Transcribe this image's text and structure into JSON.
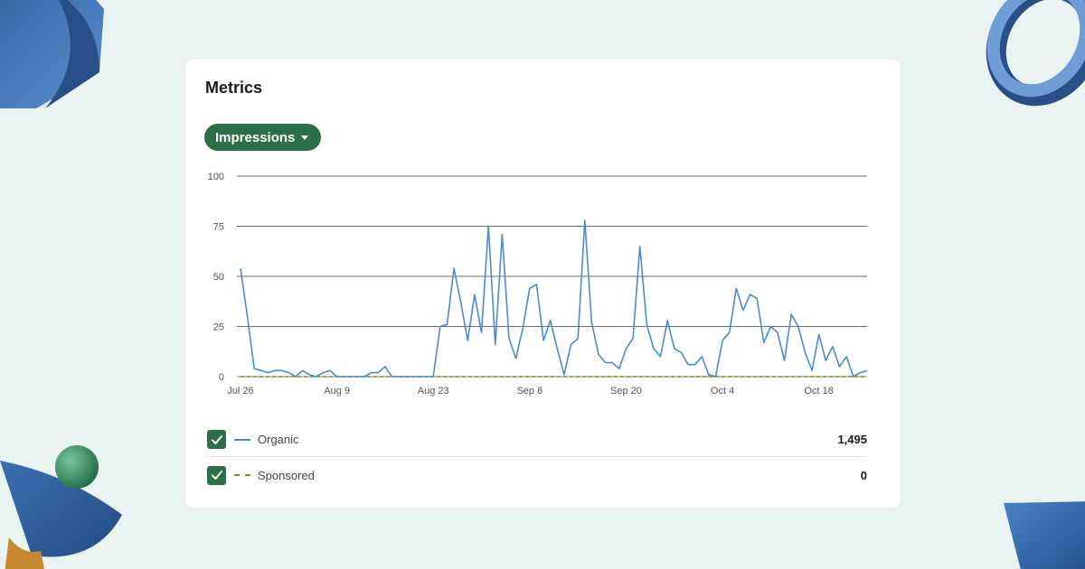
{
  "card": {
    "title": "Metrics",
    "metric_selector": {
      "selected": "Impressions"
    }
  },
  "colors": {
    "organic": "#4a8ad4",
    "sponsored": "#7b8f1a",
    "accent": "#2c6e47"
  },
  "legend": [
    {
      "name": "Organic",
      "total": "1,495",
      "checked": true,
      "style": "solid"
    },
    {
      "name": "Sponsored",
      "total": "0",
      "checked": true,
      "style": "dashed"
    }
  ],
  "chart_data": {
    "type": "line",
    "x_start": "2023-07-26",
    "x_end": "2023-10-25",
    "ylim": [
      0,
      100
    ],
    "yticks": [
      0,
      25,
      50,
      75,
      100
    ],
    "xticks": [
      {
        "label": "Jul 26",
        "day": 0
      },
      {
        "label": "Aug 9",
        "day": 14
      },
      {
        "label": "Aug 23",
        "day": 28
      },
      {
        "label": "Sep 6",
        "day": 42
      },
      {
        "label": "Sep 20",
        "day": 56
      },
      {
        "label": "Oct 4",
        "day": 70
      },
      {
        "label": "Oct 18",
        "day": 84
      }
    ],
    "grid": true,
    "series": [
      {
        "name": "Organic",
        "values": [
          54,
          30,
          4,
          3,
          2,
          3,
          3,
          2,
          0,
          3,
          1,
          0,
          2,
          3,
          0,
          0,
          0,
          0,
          0,
          2,
          2,
          5,
          0,
          0,
          0,
          0,
          0,
          0,
          0,
          25,
          26,
          54,
          37,
          18,
          41,
          22,
          75,
          16,
          71,
          19,
          9,
          24,
          44,
          46,
          18,
          28,
          14,
          1,
          16,
          19,
          78,
          27,
          11,
          7,
          7,
          4,
          14,
          19,
          65,
          26,
          14,
          10,
          28,
          14,
          12,
          6,
          6,
          10,
          1,
          0,
          18,
          22,
          44,
          33,
          41,
          39,
          17,
          25,
          22,
          8,
          31,
          25,
          12,
          3,
          21,
          8,
          15,
          5,
          10,
          0,
          2,
          3
        ]
      },
      {
        "name": "Sponsored",
        "values": [
          0,
          0,
          0,
          0,
          0,
          0,
          0,
          0,
          0,
          0,
          0,
          0,
          0,
          0,
          0,
          0,
          0,
          0,
          0,
          0,
          0,
          0,
          0,
          0,
          0,
          0,
          0,
          0,
          0,
          0,
          0,
          0,
          0,
          0,
          0,
          0,
          0,
          0,
          0,
          0,
          0,
          0,
          0,
          0,
          0,
          0,
          0,
          0,
          0,
          0,
          0,
          0,
          0,
          0,
          0,
          0,
          0,
          0,
          0,
          0,
          0,
          0,
          0,
          0,
          0,
          0,
          0,
          0,
          0,
          0,
          0,
          0,
          0,
          0,
          0,
          0,
          0,
          0,
          0,
          0,
          0,
          0,
          0,
          0,
          0,
          0,
          0,
          0,
          0,
          0,
          0,
          0
        ]
      }
    ]
  }
}
